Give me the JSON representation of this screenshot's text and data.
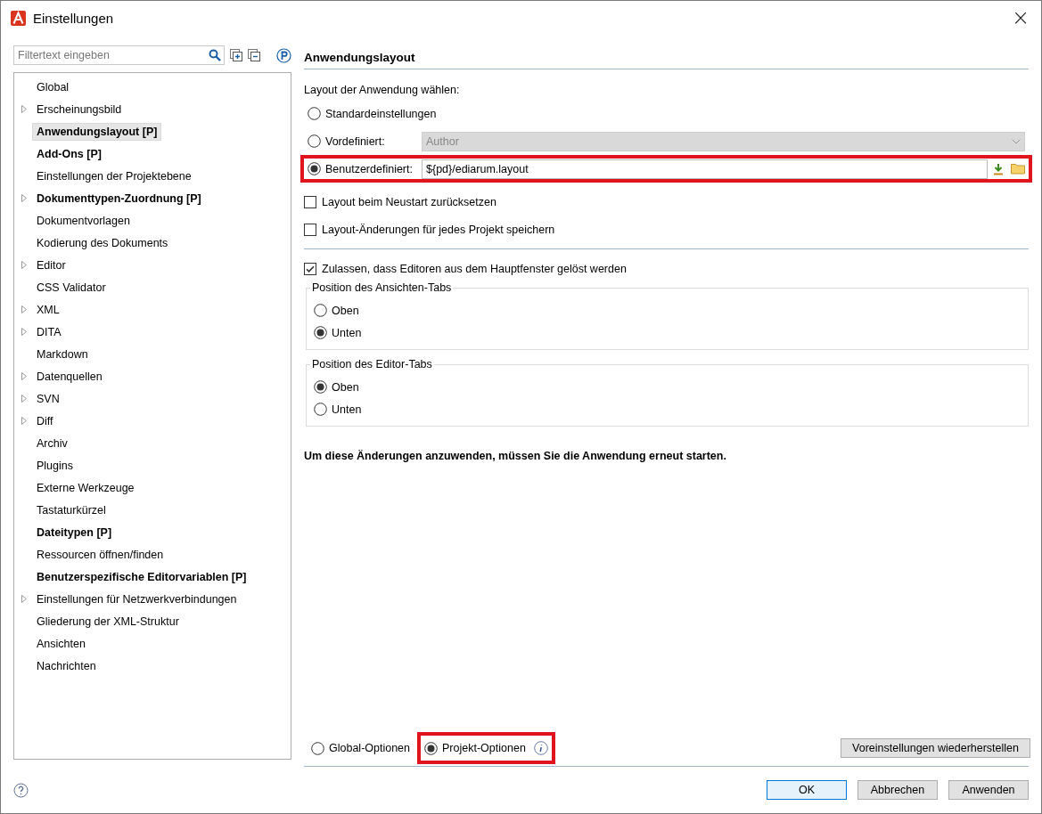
{
  "window": {
    "title": "Einstellungen",
    "close": "×"
  },
  "sidebar": {
    "filter_placeholder": "Filtertext eingeben",
    "items": [
      {
        "label": "Global",
        "expandable": false,
        "bold": false,
        "selected": false
      },
      {
        "label": "Erscheinungsbild",
        "expandable": true,
        "bold": false,
        "selected": false
      },
      {
        "label": "Anwendungslayout [P]",
        "expandable": false,
        "bold": true,
        "selected": true
      },
      {
        "label": "Add-Ons [P]",
        "expandable": false,
        "bold": true,
        "selected": false
      },
      {
        "label": "Einstellungen der Projektebene",
        "expandable": false,
        "bold": false,
        "selected": false
      },
      {
        "label": "Dokumenttypen-Zuordnung [P]",
        "expandable": true,
        "bold": true,
        "selected": false
      },
      {
        "label": "Dokumentvorlagen",
        "expandable": false,
        "bold": false,
        "selected": false
      },
      {
        "label": "Kodierung des Dokuments",
        "expandable": false,
        "bold": false,
        "selected": false
      },
      {
        "label": "Editor",
        "expandable": true,
        "bold": false,
        "selected": false
      },
      {
        "label": "CSS Validator",
        "expandable": false,
        "bold": false,
        "selected": false
      },
      {
        "label": "XML",
        "expandable": true,
        "bold": false,
        "selected": false
      },
      {
        "label": "DITA",
        "expandable": true,
        "bold": false,
        "selected": false
      },
      {
        "label": "Markdown",
        "expandable": false,
        "bold": false,
        "selected": false
      },
      {
        "label": "Datenquellen",
        "expandable": true,
        "bold": false,
        "selected": false
      },
      {
        "label": "SVN",
        "expandable": true,
        "bold": false,
        "selected": false
      },
      {
        "label": "Diff",
        "expandable": true,
        "bold": false,
        "selected": false
      },
      {
        "label": "Archiv",
        "expandable": false,
        "bold": false,
        "selected": false
      },
      {
        "label": "Plugins",
        "expandable": false,
        "bold": false,
        "selected": false
      },
      {
        "label": "Externe Werkzeuge",
        "expandable": false,
        "bold": false,
        "selected": false
      },
      {
        "label": "Tastaturkürzel",
        "expandable": false,
        "bold": false,
        "selected": false
      },
      {
        "label": "Dateitypen [P]",
        "expandable": false,
        "bold": true,
        "selected": false
      },
      {
        "label": "Ressourcen öffnen/finden",
        "expandable": false,
        "bold": false,
        "selected": false
      },
      {
        "label": "Benutzerspezifische Editorvariablen [P]",
        "expandable": false,
        "bold": true,
        "selected": false
      },
      {
        "label": "Einstellungen für Netzwerkverbindungen",
        "expandable": true,
        "bold": false,
        "selected": false
      },
      {
        "label": "Gliederung der XML-Struktur",
        "expandable": false,
        "bold": false,
        "selected": false
      },
      {
        "label": "Ansichten",
        "expandable": false,
        "bold": false,
        "selected": false
      },
      {
        "label": "Nachrichten",
        "expandable": false,
        "bold": false,
        "selected": false
      }
    ]
  },
  "page": {
    "heading": "Anwendungslayout",
    "layout_label": "Layout der Anwendung wählen:",
    "layout_options": [
      {
        "kind": "plain",
        "label": "Standardeinstellungen",
        "selected": false,
        "highlighted": false
      },
      {
        "kind": "dropdown",
        "label": "Vordefiniert:",
        "value": "Author",
        "disabled": true,
        "selected": false,
        "highlighted": false
      },
      {
        "kind": "path",
        "label": "Benutzerdefiniert:",
        "value": "${pd}/ediarum.layout",
        "selected": true,
        "highlighted": true
      }
    ],
    "checkboxes": [
      {
        "label": "Layout beim Neustart zurücksetzen",
        "checked": false
      },
      {
        "label": "Layout-Änderungen für jedes Projekt speichern",
        "checked": false
      }
    ],
    "detach_checkbox": {
      "label": "Zulassen, dass Editoren aus dem Hauptfenster gelöst werden",
      "checked": true
    },
    "groups": [
      {
        "title": "Position des Ansichten-Tabs",
        "options": [
          {
            "label": "Oben",
            "selected": false
          },
          {
            "label": "Unten",
            "selected": true
          }
        ]
      },
      {
        "title": "Position des Editor-Tabs",
        "options": [
          {
            "label": "Oben",
            "selected": true
          },
          {
            "label": "Unten",
            "selected": false
          }
        ]
      }
    ],
    "restart_note": "Um diese Änderungen anzuwenden, müssen Sie die Anwendung erneut starten.",
    "scope_options": [
      {
        "label": "Global-Optionen",
        "selected": false,
        "highlighted": false,
        "info": false
      },
      {
        "label": "Projekt-Optionen",
        "selected": true,
        "highlighted": true,
        "info": true
      }
    ],
    "restore_button": "Voreinstellungen wiederherstellen"
  },
  "buttons": [
    {
      "label": "OK",
      "default": true
    },
    {
      "label": "Abbrechen",
      "default": false
    },
    {
      "label": "Anwenden",
      "default": false
    }
  ]
}
